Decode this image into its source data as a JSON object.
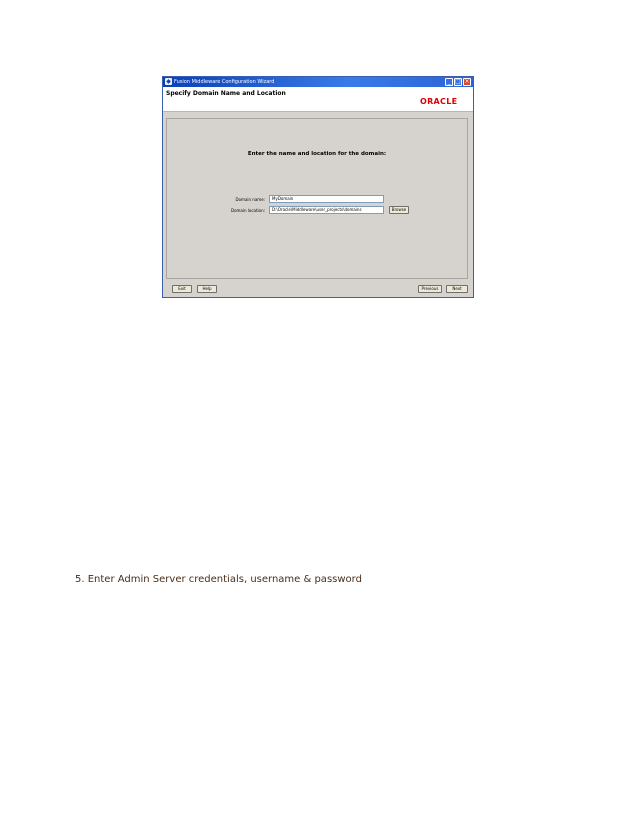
{
  "window": {
    "title": "Fusion Middleware Configuration Wizard",
    "header_title": "Specify Domain Name and Location",
    "logo": "ORACLE",
    "prompt": "Enter the name and location for the domain:",
    "domain_name": {
      "label": "Domain name:",
      "value": "MyDomain"
    },
    "domain_location": {
      "label": "Domain location:",
      "value": "D:\\Oracle\\Middleware\\user_projects\\domains"
    },
    "browse_label": "Browse",
    "footer": {
      "exit": "Exit",
      "help": "Help",
      "previous": "Previous",
      "next": "Next"
    },
    "colors": {
      "titlebar": "#2a63d8",
      "logo": "#e00000",
      "panel": "#d6d3ce"
    }
  },
  "instruction": "5. Enter Admin Server  credentials,  username  & password"
}
